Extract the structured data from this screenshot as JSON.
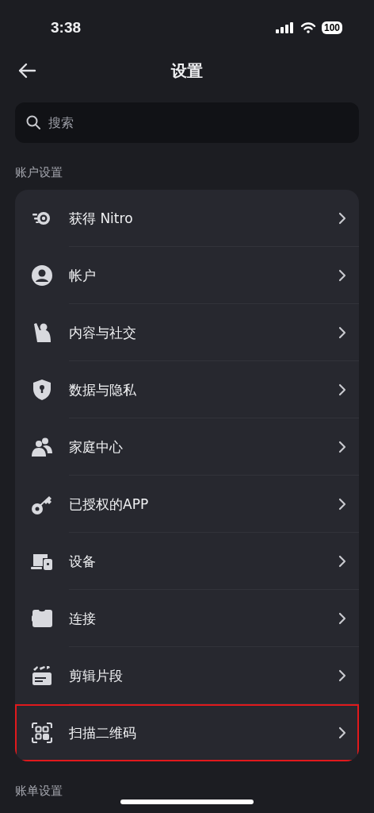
{
  "status_bar": {
    "time": "3:38",
    "battery": "100"
  },
  "header": {
    "title": "设置"
  },
  "search": {
    "placeholder": "搜索"
  },
  "sections": [
    {
      "title": "账户设置",
      "items": [
        {
          "kind": "nitro",
          "label": "获得 Nitro",
          "highlighted": false
        },
        {
          "kind": "account",
          "label": "帐户",
          "highlighted": false
        },
        {
          "kind": "content",
          "label": "内容与社交",
          "highlighted": false
        },
        {
          "kind": "privacy",
          "label": "数据与隐私",
          "highlighted": false
        },
        {
          "kind": "family",
          "label": "家庭中心",
          "highlighted": false
        },
        {
          "kind": "apps",
          "label": "已授权的APP",
          "highlighted": false
        },
        {
          "kind": "devices",
          "label": "设备",
          "highlighted": false
        },
        {
          "kind": "connections",
          "label": "连接",
          "highlighted": false
        },
        {
          "kind": "clips",
          "label": "剪辑片段",
          "highlighted": false
        },
        {
          "kind": "qr",
          "label": "扫描二维码",
          "highlighted": true
        }
      ]
    },
    {
      "title": "账单设置"
    }
  ]
}
